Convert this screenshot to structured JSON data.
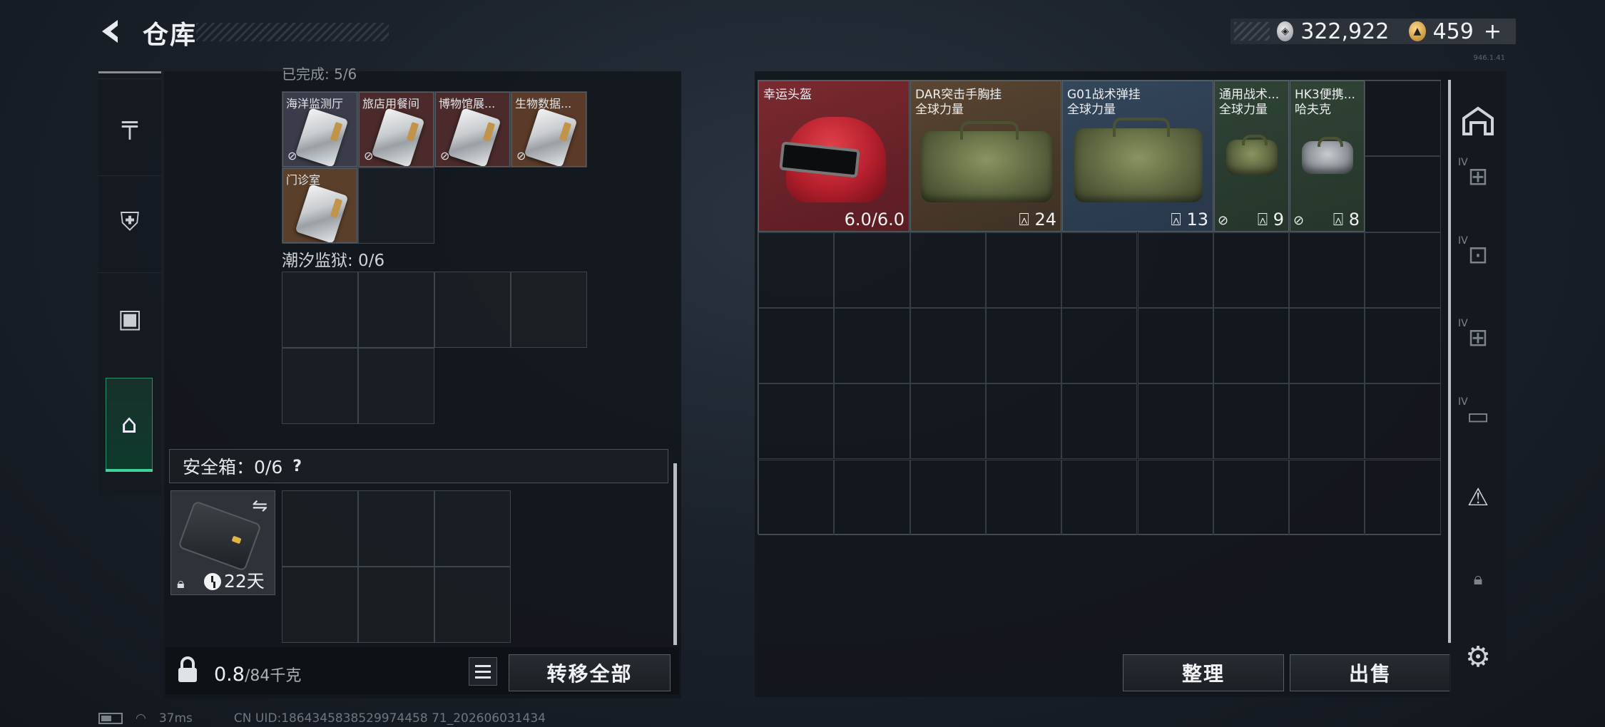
{
  "header": {
    "title": "仓库",
    "silver_amount": "322,922",
    "gold_amount": "459",
    "gold_plus": "+",
    "version": "946.1.41"
  },
  "left_nav": {
    "items": [
      {
        "icon": "pistol-icon"
      },
      {
        "icon": "armor-vest-icon"
      },
      {
        "icon": "backpack-icon"
      },
      {
        "icon": "briefcase-icon",
        "active": true
      }
    ]
  },
  "left_panel": {
    "partial_label": "已完成: 5/6",
    "keycards": [
      {
        "name": "海洋监测厅",
        "bg": "#3a3c4a"
      },
      {
        "name": "旅店用餐间",
        "bg": "#4a2a2a"
      },
      {
        "name": "博物馆展...",
        "bg": "#4a2a2a"
      },
      {
        "name": "生物数据...",
        "bg": "#5a3a28"
      },
      {
        "name": "门诊室",
        "bg": "#5a3f2a"
      }
    ],
    "prison_label": "潮汐监狱: 0/6",
    "safe_box_label": "安全箱：0/6",
    "help": "?",
    "case_days": "22天",
    "weight_value": "0.8",
    "weight_max": "/84千克",
    "transfer_all": "转移全部"
  },
  "right_panel": {
    "items": [
      {
        "name": "幸运头盔",
        "sub": "",
        "value": "6.0/6.0",
        "bg": "#6b1e24"
      },
      {
        "name": "DAR突击手胸挂",
        "sub": "全球力量",
        "value": "24",
        "bg": "#4a3a2a"
      },
      {
        "name": "G01战术弹挂",
        "sub": "全球力量",
        "value": "13",
        "bg": "#2c3a4a"
      },
      {
        "name": "通用战术...",
        "sub": "全球力量",
        "value": "9",
        "bg": "#2b3b30"
      },
      {
        "name": "HK3便携...",
        "sub": "哈夫克",
        "value": "8",
        "bg": "#2b3b30"
      }
    ],
    "sort_button": "整理",
    "sell_button": "出售"
  },
  "right_nav": {
    "items": [
      {
        "icon": "storage-icon",
        "label": ""
      },
      {
        "icon": "add-container-icon",
        "label": "IV"
      },
      {
        "icon": "container-search-icon",
        "label": "IV"
      },
      {
        "icon": "add-container-icon",
        "label": "IV"
      },
      {
        "icon": "container-icon",
        "label": "IV"
      },
      {
        "icon": "warning-container-icon",
        "label": ""
      },
      {
        "icon": "lock-icon",
        "label": ""
      },
      {
        "icon": "settings-icon",
        "label": ""
      }
    ]
  },
  "status_bar": {
    "ping": "37ms",
    "uid": "CN UID:1864345838529974458 71_202606031434"
  }
}
